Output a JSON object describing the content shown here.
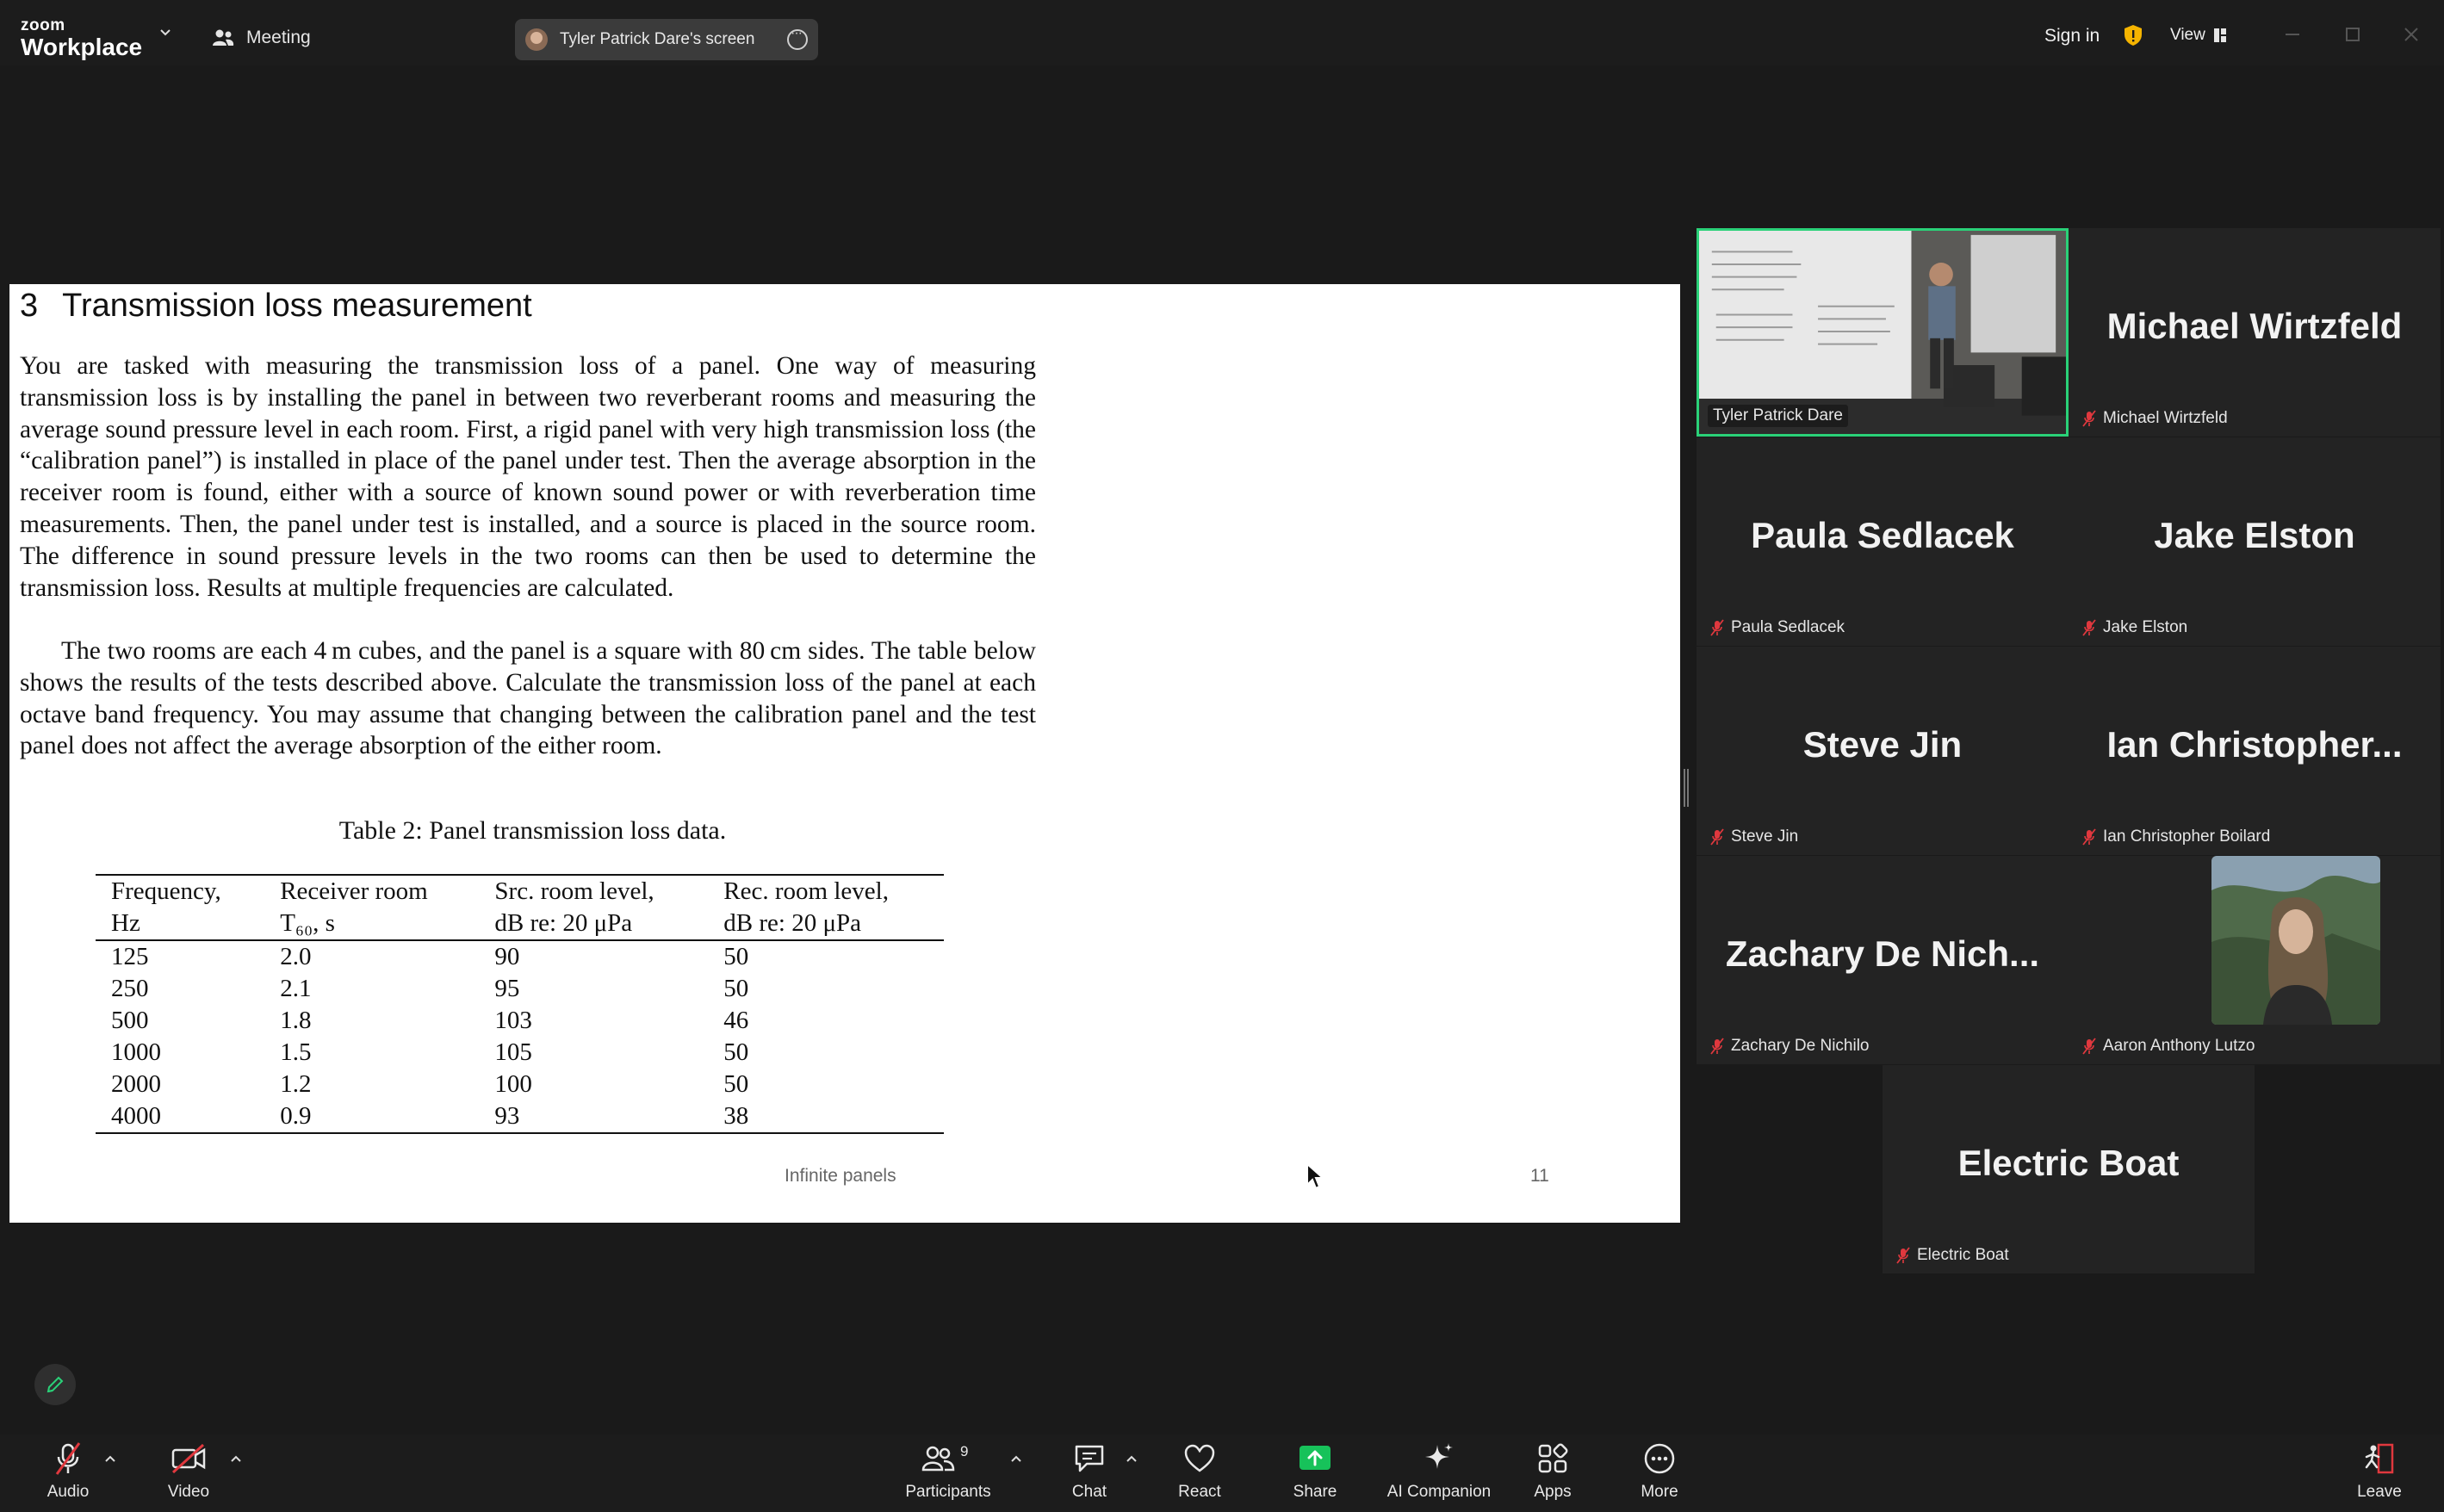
{
  "topbar": {
    "brand_small": "zoom",
    "brand_big": "Workplace",
    "meeting_label": "Meeting",
    "share_pill_label": "Tyler Patrick Dare's screen",
    "signin_label": "Sign in",
    "view_label": "View"
  },
  "slide": {
    "section_number": "3",
    "section_title": "Transmission loss measurement",
    "paragraph1": "You are tasked with measuring the transmission loss of a panel. One way of measuring transmission loss is by installing the panel in between two reverberant rooms and measuring the average sound pressure level in each room. First, a rigid panel with very high transmission loss (the “calibration panel”) is installed in place of the panel under test. Then the average absorption in the receiver room is found, either with a source of known sound power or with reverberation time measurements. Then, the panel under test is installed, and a source is placed in the source room. The difference in sound pressure levels in the two rooms can then be used to determine the transmission loss. Results at multiple frequencies are calculated.",
    "paragraph2": "The two rooms are each 4 m cubes, and the panel is a square with 80 cm sides. The table below shows the results of the tests described above. Calculate the transmission loss of the panel at each octave band frequency. You may assume that changing between the calibration panel and the test panel does not affect the average absorption of the either room.",
    "table_caption": "Table 2: Panel transmission loss data.",
    "table": {
      "headers": [
        [
          "Frequency,",
          "Hz"
        ],
        [
          "Receiver room",
          "T₆₀, s"
        ],
        [
          "Src. room level,",
          "dB re: 20 μPa"
        ],
        [
          "Rec. room level,",
          "dB re: 20 μPa"
        ]
      ],
      "rows": [
        [
          "125",
          "2.0",
          "90",
          "50"
        ],
        [
          "250",
          "2.1",
          "95",
          "50"
        ],
        [
          "500",
          "1.8",
          "103",
          "46"
        ],
        [
          "1000",
          "1.5",
          "105",
          "50"
        ],
        [
          "2000",
          "1.2",
          "100",
          "50"
        ],
        [
          "4000",
          "0.9",
          "93",
          "38"
        ]
      ]
    },
    "footer_text": "Infinite panels",
    "page_number": "11"
  },
  "gallery": {
    "tiles": [
      {
        "name": "Tyler Patrick Dare",
        "display": "Tyler Patrick Dare",
        "muted": false
      },
      {
        "name": "Michael Wirtzfeld",
        "display": "Michael Wirtzfeld",
        "muted": true
      },
      {
        "name": "Paula Sedlacek",
        "display": "Paula Sedlacek",
        "muted": true
      },
      {
        "name": "Jake Elston",
        "display": "Jake Elston",
        "muted": true
      },
      {
        "name": "Steve Jin",
        "display": "Steve Jin",
        "muted": true
      },
      {
        "name": "Ian Christopher Boilard",
        "display": "Ian  Christopher...",
        "muted": true
      },
      {
        "name": "Zachary De Nichilo",
        "display": "Zachary  De  Nich...",
        "muted": true
      },
      {
        "name": "Aaron Anthony Lutzo",
        "display": "",
        "muted": true
      },
      {
        "name": "Electric Boat",
        "display": "Electric Boat",
        "muted": true
      }
    ]
  },
  "toolbar": {
    "audio": "Audio",
    "video": "Video",
    "participants": "Participants",
    "participants_count": "9",
    "chat": "Chat",
    "react": "React",
    "share": "Share",
    "ai_companion": "AI Companion",
    "apps": "Apps",
    "more": "More",
    "leave": "Leave"
  },
  "colors": {
    "active_speaker_border": "#2ad178",
    "share_green": "#17c25a",
    "muted_red": "#e0383e",
    "shield_yellow": "#f5b400"
  }
}
